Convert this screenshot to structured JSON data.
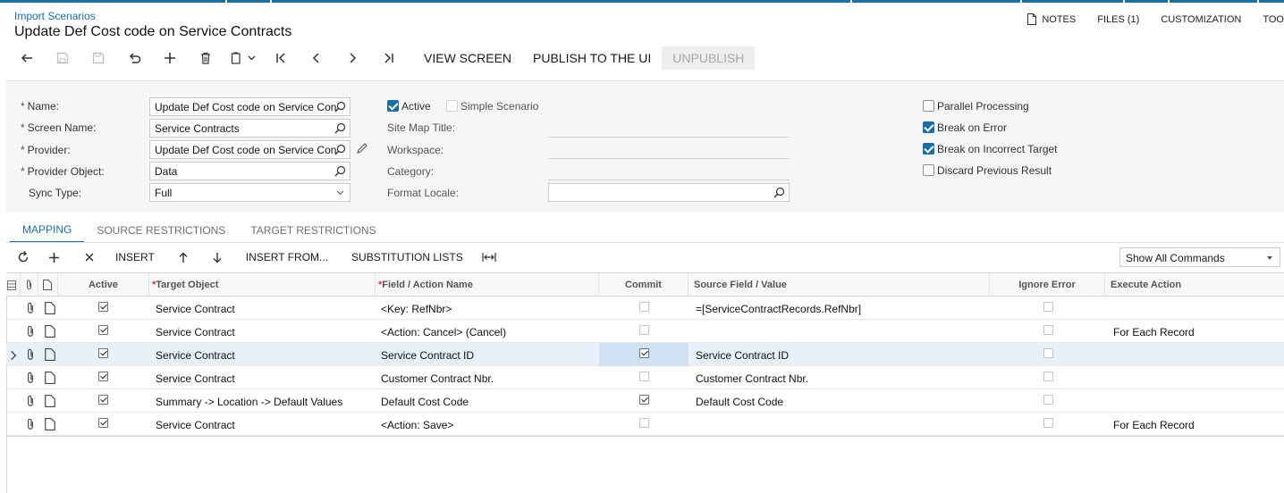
{
  "header": {
    "breadcrumb": "Import Scenarios",
    "title": "Update Def Cost code on Service Contracts",
    "top_right": {
      "notes": "NOTES",
      "files": "FILES (1)",
      "customization": "CUSTOMIZATION",
      "tools": "TOO"
    }
  },
  "toolbar": {
    "view_screen": "VIEW SCREEN",
    "publish": "PUBLISH TO THE UI",
    "unpublish": "UNPUBLISH"
  },
  "form": {
    "name_label": "Name:",
    "name_value": "Update Def Cost code on Service Con",
    "screen_name_label": "Screen Name:",
    "screen_name_value": "Service Contracts",
    "provider_label": "Provider:",
    "provider_value": "Update Def Cost code on Service Con",
    "provider_object_label": "Provider Object:",
    "provider_object_value": "Data",
    "sync_type_label": "Sync Type:",
    "sync_type_value": "Full",
    "active_label": "Active",
    "active_checked": true,
    "simple_scenario_label": "Simple Scenario",
    "simple_scenario_checked": false,
    "site_map_title_label": "Site Map Title:",
    "workspace_label": "Workspace:",
    "category_label": "Category:",
    "format_locale_label": "Format Locale:",
    "format_locale_value": "",
    "parallel_processing_label": "Parallel Processing",
    "parallel_processing_checked": false,
    "break_on_error_label": "Break on Error",
    "break_on_error_checked": true,
    "break_on_incorrect_target_label": "Break on Incorrect Target",
    "break_on_incorrect_target_checked": true,
    "discard_previous_result_label": "Discard Previous Result",
    "discard_previous_result_checked": false
  },
  "tabs": [
    "MAPPING",
    "SOURCE RESTRICTIONS",
    "TARGET RESTRICTIONS"
  ],
  "grid_toolbar": {
    "insert": "INSERT",
    "insert_from": "INSERT FROM...",
    "substitution_lists": "SUBSTITUTION LISTS",
    "command_filter": "Show All Commands"
  },
  "grid": {
    "columns": {
      "active": "Active",
      "target_object": "Target Object",
      "field_action": "Field / Action Name",
      "commit": "Commit",
      "source_field": "Source Field / Value",
      "ignore_error": "Ignore Error",
      "execute_action": "Execute Action"
    },
    "rows": [
      {
        "active": true,
        "target_object": "Service Contract",
        "field_action": "<Key: RefNbr>",
        "commit": false,
        "source_field": "=[ServiceContractRecords.RefNbr]",
        "ignore_error": false,
        "execute_action": ""
      },
      {
        "active": true,
        "target_object": "Service Contract",
        "field_action": "<Action: Cancel> (Cancel)",
        "commit": false,
        "source_field": "",
        "ignore_error": false,
        "execute_action": "For Each Record"
      },
      {
        "active": true,
        "target_object": "Service Contract",
        "field_action": "Service Contract ID",
        "commit": true,
        "source_field": "Service Contract ID",
        "ignore_error": false,
        "execute_action": ""
      },
      {
        "active": true,
        "target_object": "Service Contract",
        "field_action": "Customer Contract Nbr.",
        "commit": false,
        "source_field": "Customer Contract Nbr.",
        "ignore_error": false,
        "execute_action": ""
      },
      {
        "active": true,
        "target_object": "Summary -> Location -> Default Values",
        "field_action": "Default Cost Code",
        "commit": true,
        "source_field": "Default Cost Code",
        "ignore_error": false,
        "execute_action": ""
      },
      {
        "active": true,
        "target_object": "Service Contract",
        "field_action": "<Action: Save>",
        "commit": false,
        "source_field": "",
        "ignore_error": false,
        "execute_action": "For Each Record"
      }
    ]
  },
  "colors": {
    "accent": "#1b6ea8",
    "selected_row": "#e8f1f9"
  }
}
